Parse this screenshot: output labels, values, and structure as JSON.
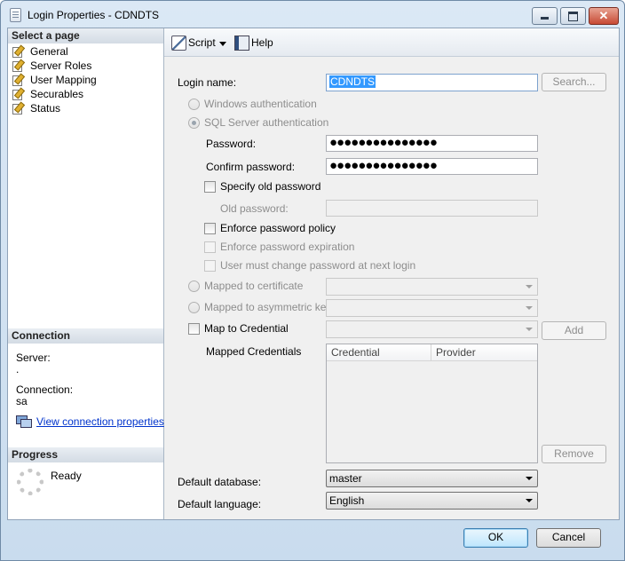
{
  "window": {
    "title": "Login Properties - CDNDTS",
    "close_glyph": "✕"
  },
  "left_pane": {
    "select_page_header": "Select a page",
    "pages": [
      {
        "label": "General",
        "selected": true
      },
      {
        "label": "Server Roles"
      },
      {
        "label": "User Mapping"
      },
      {
        "label": "Securables"
      },
      {
        "label": "Status"
      }
    ],
    "connection_header": "Connection",
    "server_label": "Server:",
    "server_value": ".",
    "connection_label": "Connection:",
    "connection_value": "sa",
    "view_connection_link": "View connection properties",
    "progress_header": "Progress",
    "progress_status": "Ready"
  },
  "toolbar": {
    "script_label": "Script",
    "help_label": "Help"
  },
  "general": {
    "login_name_label": "Login name:",
    "login_name_value": "CDNDTS",
    "search_button": "Search...",
    "windows_auth": "Windows authentication",
    "sql_auth": "SQL Server authentication",
    "password_label": "Password:",
    "password_value": "●●●●●●●●●●●●●●●",
    "confirm_password_label": "Confirm password:",
    "confirm_password_value": "●●●●●●●●●●●●●●●",
    "specify_old_password": "Specify old password",
    "old_password_label": "Old password:",
    "enforce_policy": "Enforce password policy",
    "enforce_expiration": "Enforce password expiration",
    "must_change": "User must change password at next login",
    "mapped_to_certificate": "Mapped to certificate",
    "mapped_to_asym_key": "Mapped to asymmetric key",
    "map_to_credential": "Map to Credential",
    "add_button": "Add",
    "mapped_credentials_label": "Mapped Credentials",
    "credential_columns": [
      "Credential",
      "Provider"
    ],
    "remove_button": "Remove",
    "default_database_label": "Default database:",
    "default_database_value": "master",
    "default_language_label": "Default language:",
    "default_language_value": "English"
  },
  "footer": {
    "ok_button": "OK",
    "cancel_button": "Cancel"
  }
}
